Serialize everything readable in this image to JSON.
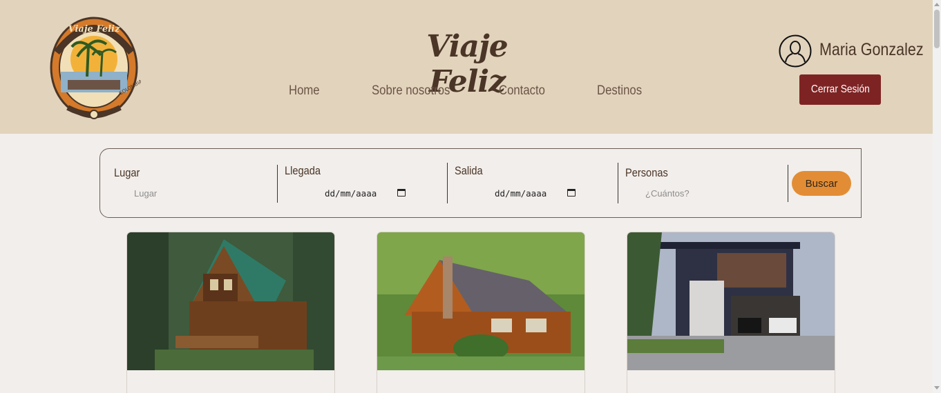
{
  "header": {
    "brand_title": "Viaje Feliz",
    "logo_alt": "Viaje Feliz logo",
    "nav": [
      "Home",
      "Sobre nosotros",
      "Contacto",
      "Destinos"
    ],
    "user_name": "Maria Gonzalez",
    "logout_label": "Cerrar Sesión"
  },
  "search": {
    "lugar_label": "Lugar",
    "lugar_placeholder": "Lugar",
    "llegada_label": "Llegada",
    "llegada_value": "dd/mm/aaaa",
    "salida_label": "Salida",
    "salida_value": "dd/mm/aaaa",
    "personas_label": "Personas",
    "personas_placeholder": "¿Cuántos?",
    "button_label": "Buscar"
  },
  "cards": [
    {
      "image": "log-cabin-forest"
    },
    {
      "image": "wooden-house-trees"
    },
    {
      "image": "modern-house-palm"
    }
  ],
  "colors": {
    "header_bg": "#e2d3bd",
    "page_bg": "#f2eeeb",
    "logout_bg": "#7e2323",
    "search_button": "#e28d35",
    "text_dark": "#4a3526"
  }
}
